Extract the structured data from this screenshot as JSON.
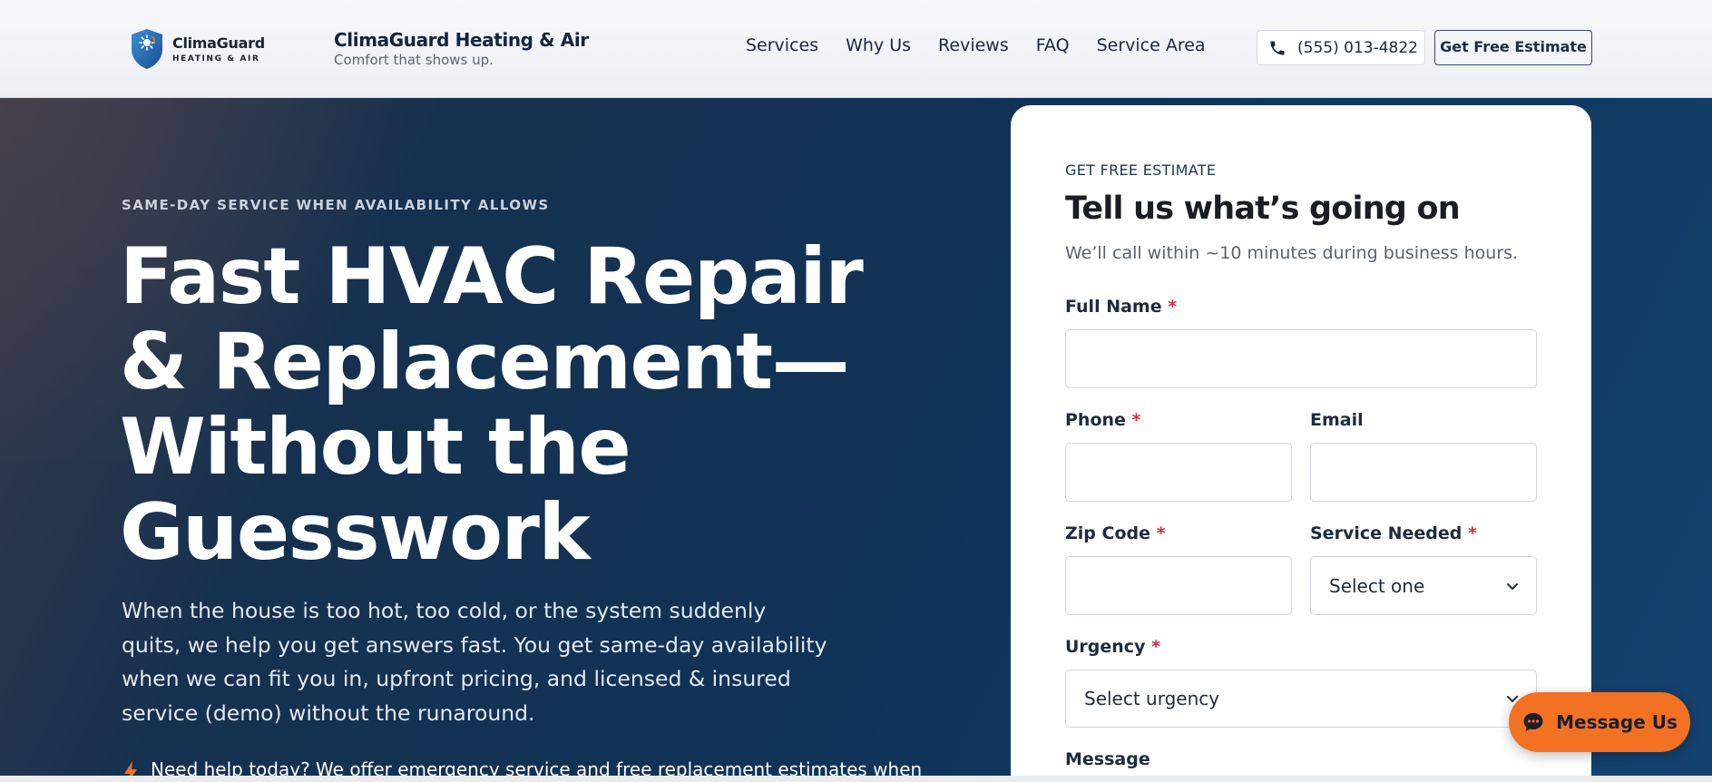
{
  "header": {
    "logo_name": "ClimaGuard",
    "logo_sub": "HEATING & AIR",
    "brand_title": "ClimaGuard Heating & Air",
    "brand_tagline": "Comfort that shows up.",
    "nav": [
      "Services",
      "Why Us",
      "Reviews",
      "FAQ",
      "Service Area"
    ],
    "phone": "(555) 013-4822",
    "estimate_label": "Get Free Estimate"
  },
  "hero": {
    "eyebrow": "SAME-DAY SERVICE WHEN AVAILABILITY ALLOWS",
    "title": "Fast HVAC Repair & Replacement—Without the Guesswork",
    "description": "When the house is too hot, too cold, or the system suddenly quits, we help you get answers fast. You get same-day availability when we can fit you in, upfront pricing, and licensed & insured service (demo) without the runaround.",
    "note": "Need help today? We offer emergency service and free replacement estimates when"
  },
  "form": {
    "eyebrow": "GET FREE ESTIMATE",
    "title": "Tell us what’s going on",
    "subtitle": "We’ll call within ~10 minutes during business hours.",
    "full_name_label": "Full Name",
    "phone_label": "Phone",
    "email_label": "Email",
    "zip_label": "Zip Code",
    "service_label": "Service Needed",
    "service_placeholder": "Select one",
    "urgency_label": "Urgency",
    "urgency_placeholder": "Select urgency",
    "message_label": "Message",
    "required_mark": "*"
  },
  "chat": {
    "label": "Message Us"
  },
  "colors": {
    "accent_orange": "#f37123",
    "navy": "#103358",
    "required_red": "#d42f3a"
  }
}
